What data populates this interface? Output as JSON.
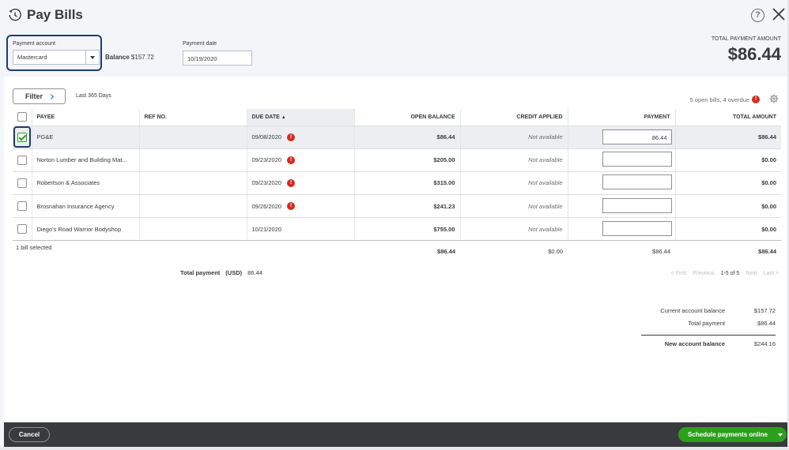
{
  "window": {
    "title": "Pay Bills"
  },
  "payment_account": {
    "label": "Payment account",
    "value": "Mastercard",
    "balance_label": "Balance",
    "balance_value": "$157.72"
  },
  "payment_date": {
    "label": "Payment date",
    "value": "10/19/2020"
  },
  "total_payment_amount": {
    "label": "TOTAL PAYMENT AMOUNT",
    "value": "$86.44"
  },
  "filter": {
    "label": "Filter",
    "range": "Last 365 Days"
  },
  "bills_summary": {
    "text": "5 open bills, 4 overdue",
    "alert": "!"
  },
  "table": {
    "headers": {
      "payee": "PAYEE",
      "ref": "REF NO.",
      "due": "DUE DATE",
      "open": "OPEN BALANCE",
      "credit": "CREDIT APPLIED",
      "payment": "PAYMENT",
      "total": "TOTAL AMOUNT"
    },
    "sort_indicator": "▲",
    "rows": [
      {
        "payee": "PG&E",
        "ref": "",
        "due": "09/08/2020",
        "overdue": true,
        "open": "$86.44",
        "credit": "Not available",
        "payment": "86.44",
        "total": "$86.44",
        "checked": true
      },
      {
        "payee": "Norton Lumber and Building Mat...",
        "ref": "",
        "due": "09/23/2020",
        "overdue": true,
        "open": "$205.00",
        "credit": "Not available",
        "payment": "",
        "total": "$0.00",
        "checked": false
      },
      {
        "payee": "Robertson & Associates",
        "ref": "",
        "due": "09/23/2020",
        "overdue": true,
        "open": "$315.00",
        "credit": "Not available",
        "payment": "",
        "total": "$0.00",
        "checked": false
      },
      {
        "payee": "Brosnahan Insurance Agency",
        "ref": "",
        "due": "09/26/2020",
        "overdue": true,
        "open": "$241.23",
        "credit": "Not available",
        "payment": "",
        "total": "$0.00",
        "checked": false
      },
      {
        "payee": "Diego's Road Warrior Bodyshop",
        "ref": "",
        "due": "10/21/2020",
        "overdue": false,
        "open": "$755.00",
        "credit": "Not available",
        "payment": "",
        "total": "$0.00",
        "checked": false
      }
    ],
    "footer": {
      "selected": "1 bill selected",
      "open": "$86.44",
      "credit": "$0.00",
      "payment": "$86.44",
      "total": "$86.44"
    }
  },
  "total_payment": {
    "label": "Total payment",
    "currency": "(USD)",
    "value": "86.44"
  },
  "pagination": {
    "first": "< First",
    "previous": "Previous",
    "range": "1-5 of 5",
    "next": "Next",
    "last": "Last >"
  },
  "account_summary": {
    "current_label": "Current account balance",
    "current_value": "$157.72",
    "total_label": "Total payment",
    "total_value": "$86.44",
    "new_label": "New account balance",
    "new_value": "$244.16"
  },
  "footer_bar": {
    "cancel": "Cancel",
    "schedule": "Schedule payments online"
  },
  "colors": {
    "accent_green": "#2ca01c",
    "overdue_red": "#d52b1e",
    "link_blue": "#0077c5",
    "highlight_navy": "#1f3c6e"
  }
}
